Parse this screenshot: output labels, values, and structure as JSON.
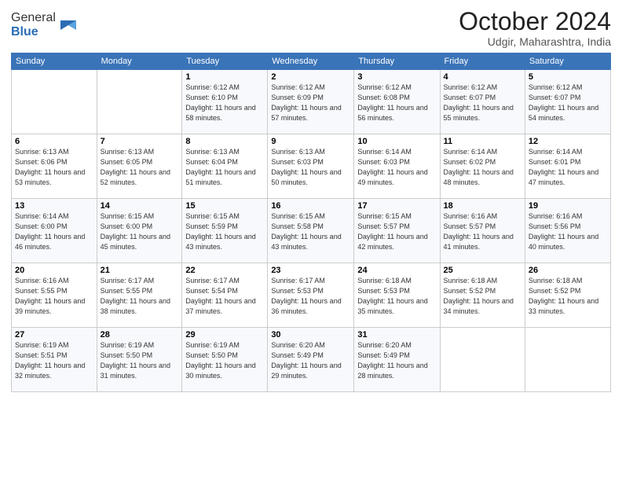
{
  "logo": {
    "general": "General",
    "blue": "Blue"
  },
  "title": "October 2024",
  "subtitle": "Udgir, Maharashtra, India",
  "days_of_week": [
    "Sunday",
    "Monday",
    "Tuesday",
    "Wednesday",
    "Thursday",
    "Friday",
    "Saturday"
  ],
  "weeks": [
    [
      {
        "day": "",
        "sunrise": "",
        "sunset": "",
        "daylight": ""
      },
      {
        "day": "",
        "sunrise": "",
        "sunset": "",
        "daylight": ""
      },
      {
        "day": "1",
        "sunrise": "Sunrise: 6:12 AM",
        "sunset": "Sunset: 6:10 PM",
        "daylight": "Daylight: 11 hours and 58 minutes."
      },
      {
        "day": "2",
        "sunrise": "Sunrise: 6:12 AM",
        "sunset": "Sunset: 6:09 PM",
        "daylight": "Daylight: 11 hours and 57 minutes."
      },
      {
        "day": "3",
        "sunrise": "Sunrise: 6:12 AM",
        "sunset": "Sunset: 6:08 PM",
        "daylight": "Daylight: 11 hours and 56 minutes."
      },
      {
        "day": "4",
        "sunrise": "Sunrise: 6:12 AM",
        "sunset": "Sunset: 6:07 PM",
        "daylight": "Daylight: 11 hours and 55 minutes."
      },
      {
        "day": "5",
        "sunrise": "Sunrise: 6:12 AM",
        "sunset": "Sunset: 6:07 PM",
        "daylight": "Daylight: 11 hours and 54 minutes."
      }
    ],
    [
      {
        "day": "6",
        "sunrise": "Sunrise: 6:13 AM",
        "sunset": "Sunset: 6:06 PM",
        "daylight": "Daylight: 11 hours and 53 minutes."
      },
      {
        "day": "7",
        "sunrise": "Sunrise: 6:13 AM",
        "sunset": "Sunset: 6:05 PM",
        "daylight": "Daylight: 11 hours and 52 minutes."
      },
      {
        "day": "8",
        "sunrise": "Sunrise: 6:13 AM",
        "sunset": "Sunset: 6:04 PM",
        "daylight": "Daylight: 11 hours and 51 minutes."
      },
      {
        "day": "9",
        "sunrise": "Sunrise: 6:13 AM",
        "sunset": "Sunset: 6:03 PM",
        "daylight": "Daylight: 11 hours and 50 minutes."
      },
      {
        "day": "10",
        "sunrise": "Sunrise: 6:14 AM",
        "sunset": "Sunset: 6:03 PM",
        "daylight": "Daylight: 11 hours and 49 minutes."
      },
      {
        "day": "11",
        "sunrise": "Sunrise: 6:14 AM",
        "sunset": "Sunset: 6:02 PM",
        "daylight": "Daylight: 11 hours and 48 minutes."
      },
      {
        "day": "12",
        "sunrise": "Sunrise: 6:14 AM",
        "sunset": "Sunset: 6:01 PM",
        "daylight": "Daylight: 11 hours and 47 minutes."
      }
    ],
    [
      {
        "day": "13",
        "sunrise": "Sunrise: 6:14 AM",
        "sunset": "Sunset: 6:00 PM",
        "daylight": "Daylight: 11 hours and 46 minutes."
      },
      {
        "day": "14",
        "sunrise": "Sunrise: 6:15 AM",
        "sunset": "Sunset: 6:00 PM",
        "daylight": "Daylight: 11 hours and 45 minutes."
      },
      {
        "day": "15",
        "sunrise": "Sunrise: 6:15 AM",
        "sunset": "Sunset: 5:59 PM",
        "daylight": "Daylight: 11 hours and 43 minutes."
      },
      {
        "day": "16",
        "sunrise": "Sunrise: 6:15 AM",
        "sunset": "Sunset: 5:58 PM",
        "daylight": "Daylight: 11 hours and 43 minutes."
      },
      {
        "day": "17",
        "sunrise": "Sunrise: 6:15 AM",
        "sunset": "Sunset: 5:57 PM",
        "daylight": "Daylight: 11 hours and 42 minutes."
      },
      {
        "day": "18",
        "sunrise": "Sunrise: 6:16 AM",
        "sunset": "Sunset: 5:57 PM",
        "daylight": "Daylight: 11 hours and 41 minutes."
      },
      {
        "day": "19",
        "sunrise": "Sunrise: 6:16 AM",
        "sunset": "Sunset: 5:56 PM",
        "daylight": "Daylight: 11 hours and 40 minutes."
      }
    ],
    [
      {
        "day": "20",
        "sunrise": "Sunrise: 6:16 AM",
        "sunset": "Sunset: 5:55 PM",
        "daylight": "Daylight: 11 hours and 39 minutes."
      },
      {
        "day": "21",
        "sunrise": "Sunrise: 6:17 AM",
        "sunset": "Sunset: 5:55 PM",
        "daylight": "Daylight: 11 hours and 38 minutes."
      },
      {
        "day": "22",
        "sunrise": "Sunrise: 6:17 AM",
        "sunset": "Sunset: 5:54 PM",
        "daylight": "Daylight: 11 hours and 37 minutes."
      },
      {
        "day": "23",
        "sunrise": "Sunrise: 6:17 AM",
        "sunset": "Sunset: 5:53 PM",
        "daylight": "Daylight: 11 hours and 36 minutes."
      },
      {
        "day": "24",
        "sunrise": "Sunrise: 6:18 AM",
        "sunset": "Sunset: 5:53 PM",
        "daylight": "Daylight: 11 hours and 35 minutes."
      },
      {
        "day": "25",
        "sunrise": "Sunrise: 6:18 AM",
        "sunset": "Sunset: 5:52 PM",
        "daylight": "Daylight: 11 hours and 34 minutes."
      },
      {
        "day": "26",
        "sunrise": "Sunrise: 6:18 AM",
        "sunset": "Sunset: 5:52 PM",
        "daylight": "Daylight: 11 hours and 33 minutes."
      }
    ],
    [
      {
        "day": "27",
        "sunrise": "Sunrise: 6:19 AM",
        "sunset": "Sunset: 5:51 PM",
        "daylight": "Daylight: 11 hours and 32 minutes."
      },
      {
        "day": "28",
        "sunrise": "Sunrise: 6:19 AM",
        "sunset": "Sunset: 5:50 PM",
        "daylight": "Daylight: 11 hours and 31 minutes."
      },
      {
        "day": "29",
        "sunrise": "Sunrise: 6:19 AM",
        "sunset": "Sunset: 5:50 PM",
        "daylight": "Daylight: 11 hours and 30 minutes."
      },
      {
        "day": "30",
        "sunrise": "Sunrise: 6:20 AM",
        "sunset": "Sunset: 5:49 PM",
        "daylight": "Daylight: 11 hours and 29 minutes."
      },
      {
        "day": "31",
        "sunrise": "Sunrise: 6:20 AM",
        "sunset": "Sunset: 5:49 PM",
        "daylight": "Daylight: 11 hours and 28 minutes."
      },
      {
        "day": "",
        "sunrise": "",
        "sunset": "",
        "daylight": ""
      },
      {
        "day": "",
        "sunrise": "",
        "sunset": "",
        "daylight": ""
      }
    ]
  ]
}
